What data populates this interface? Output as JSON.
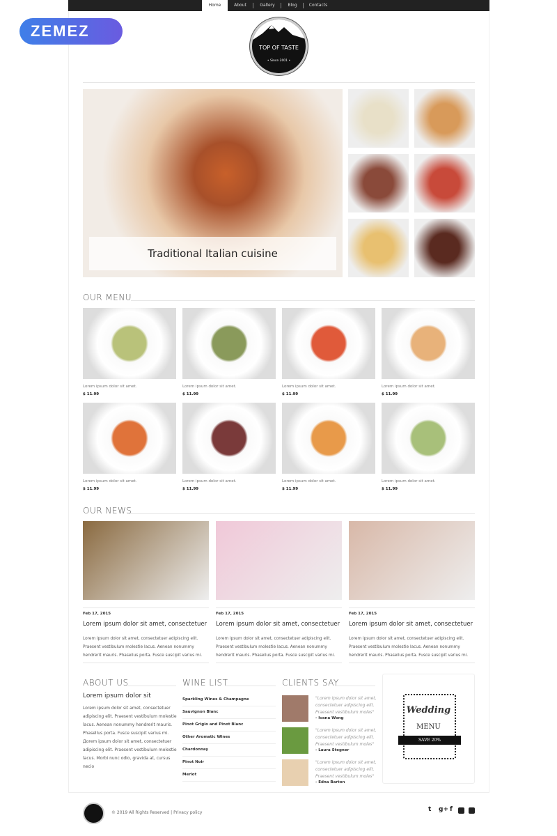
{
  "badge": {
    "label": "ZEMEZ",
    "color": "#4f6fe6"
  },
  "nav": {
    "tabs": [
      {
        "label": "Home",
        "active": true
      },
      {
        "label": "About"
      },
      {
        "label": "Gallery"
      },
      {
        "label": "Blog"
      },
      {
        "label": "Contacts"
      }
    ]
  },
  "logo": {
    "title": "TOP OF TASTE",
    "since": "• Since 2001 •"
  },
  "hero": {
    "caption": "Traditional Italian cuisine"
  },
  "gallery": [
    "ice-cream",
    "salad",
    "steak",
    "caprese",
    "coffee",
    "mulled-wine"
  ],
  "menu": {
    "heading": "OUR MENU",
    "items": [
      {
        "name": "Lorem ipsum dolor sit amet.",
        "price": "$ 11.99",
        "color": "#b9c27a"
      },
      {
        "name": "Lorem ipsum dolor sit amet.",
        "price": "$ 11.99",
        "color": "#8a9a5b"
      },
      {
        "name": "Lorem ipsum dolor sit amet.",
        "price": "$ 11.99",
        "color": "#e05a3a"
      },
      {
        "name": "Lorem ipsum dolor sit amet.",
        "price": "$ 11.99",
        "color": "#e8b27a"
      },
      {
        "name": "Lorem ipsum dolor sit amet.",
        "price": "$ 11.99",
        "color": "#e0733a"
      },
      {
        "name": "Lorem ipsum dolor sit amet.",
        "price": "$ 11.99",
        "color": "#7a3a3a"
      },
      {
        "name": "Lorem ipsum dolor sit amet.",
        "price": "$ 11.99",
        "color": "#e89a4a"
      },
      {
        "name": "Lorem ipsum dolor sit amet.",
        "price": "$ 11.99",
        "color": "#a8c07a"
      }
    ]
  },
  "news": {
    "heading": "OUR NEWS",
    "items": [
      {
        "date": "Feb 17, 2015",
        "title": "Lorem ipsum dolor sit amet, consectetuer",
        "text": "Lorem ipsum dolor sit amet, consectetuer adipiscing elit. Praesent vestibulum molestie lacus. Aenean nonummy hendrerit mauris. Phasellus porta. Fusce suscipit varius mi.",
        "color": "#8a6a40"
      },
      {
        "date": "Feb 17, 2015",
        "title": "Lorem ipsum dolor sit amet, consectetuer",
        "text": "Lorem ipsum dolor sit amet, consectetuer adipiscing elit. Praesent vestibulum molestie lacus. Aenean nonummy hendrerit mauris. Phasellus porta. Fusce suscipit varius mi.",
        "color": "#f0c8d8"
      },
      {
        "date": "Feb 17, 2015",
        "title": "Lorem ipsum dolor sit amet, consectetuer",
        "text": "Lorem ipsum dolor sit amet, consectetuer adipiscing elit. Praesent vestibulum molestie lacus. Aenean nonummy hendrerit mauris. Phasellus porta. Fusce suscipit varius mi.",
        "color": "#d8b8a8"
      }
    ]
  },
  "about": {
    "heading": "ABOUT US",
    "title": "Lorem ipsum dolor sit",
    "text": "Lorem ipsum dolor sit amet, consectetuer adipiscing elit. Praesent vestibulum molestie lacus. Aenean nonummy hendrerit mauris. Phasellus porta. Fusce suscipit varius mi. Дorem ipsum dolor sit amet, consectetuer adipiscing elit. Praesent vestibulum molestie lacus. Morbi nunc odio, gravida at, cursus necio"
  },
  "wine": {
    "heading": "WINE LIST",
    "items": [
      "Sparkling Wines & Champagne",
      "Sauvignon Blanc",
      "Pinot Grigio and Pinot Blanc",
      "Other Aromatic Wines",
      "Chardonnay",
      "Pinot Noir",
      "Merlot"
    ]
  },
  "clients": {
    "heading": "CLIENTS SAY",
    "items": [
      {
        "quote": "\"Lorem ipsum dolor sit amet, consectetuer adipiscing elit. Praesent vestibulum moles\"",
        "author": "- Ivana Wong"
      },
      {
        "quote": "\"Lorem ipsum dolor sit amet, consectetuer adipiscing elit. Praesent vestibulum moles\"",
        "author": "- Laura Stegner"
      },
      {
        "quote": "\"Lorem ipsum dolor sit amet, consectetuer adipiscing elit. Praesent vestibulum moles\"",
        "author": "- Edna Barton"
      }
    ]
  },
  "promo": {
    "title": "Wedding",
    "subtitle": "MENU",
    "ribbon": "SAVE 20%"
  },
  "footer": {
    "copyright": "© 2019 All Rights Reserved",
    "separator": "|",
    "privacy": "Privacy policy",
    "social": [
      "twitter",
      "google-plus",
      "facebook",
      "skype",
      "pinterest"
    ]
  }
}
